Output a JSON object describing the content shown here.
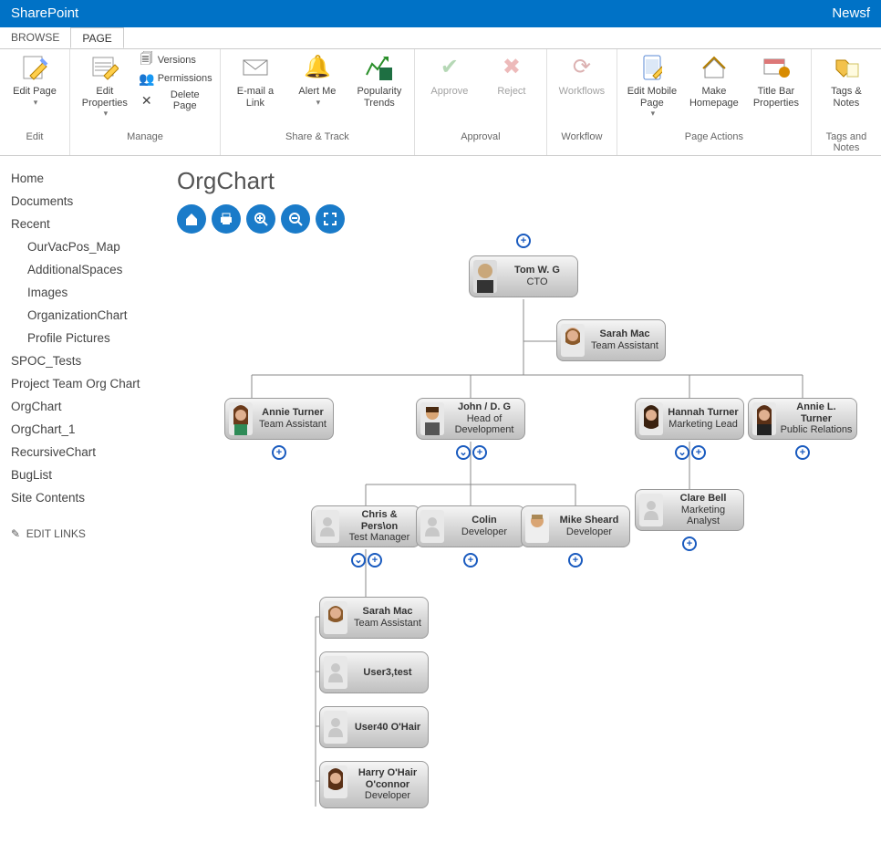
{
  "topbar": {
    "brand": "SharePoint",
    "right": "Newsf"
  },
  "tabs": {
    "browse": "BROWSE",
    "page": "PAGE"
  },
  "ribbon": {
    "edit": {
      "title": "Edit",
      "editPage": "Edit Page"
    },
    "manage": {
      "title": "Manage",
      "editProperties": "Edit Properties",
      "versions": "Versions",
      "permissions": "Permissions",
      "deletePage": "Delete Page"
    },
    "share": {
      "title": "Share & Track",
      "emailLink": "E-mail a Link",
      "alertMe": "Alert Me",
      "popularity": "Popularity Trends"
    },
    "approval": {
      "title": "Approval",
      "approve": "Approve",
      "reject": "Reject"
    },
    "workflow": {
      "title": "Workflow",
      "workflows": "Workflows"
    },
    "actions": {
      "title": "Page Actions",
      "editMobile": "Edit Mobile Page",
      "makeHome": "Make Homepage",
      "titleBar": "Title Bar Properties"
    },
    "tags": {
      "title": "Tags and Notes",
      "tagsNotes": "Tags & Notes"
    }
  },
  "sidebar": {
    "home": "Home",
    "documents": "Documents",
    "recent": "Recent",
    "recentItems": [
      "OurVacPos_Map",
      "AdditionalSpaces",
      "Images",
      "OrganizationChart",
      "Profile Pictures"
    ],
    "rest": [
      "SPOC_Tests",
      "Project Team Org Chart",
      "OrgChart",
      "OrgChart_1",
      "RecursiveChart",
      "BugList",
      "Site Contents"
    ],
    "editLinks": "EDIT LINKS"
  },
  "page": {
    "title": "OrgChart"
  },
  "nodes": {
    "tom": {
      "name": "Tom W. G",
      "title": "CTO"
    },
    "sarah1": {
      "name": "Sarah Mac",
      "title": "Team Assistant"
    },
    "annie": {
      "name": "Annie Turner",
      "title": "Team Assistant"
    },
    "john": {
      "name": "John / D. G",
      "title": "Head of Development"
    },
    "hannah": {
      "name": "Hannah Turner",
      "title": "Marketing Lead"
    },
    "anniel": {
      "name": "Annie L. Turner",
      "title": "Public Relations"
    },
    "chris": {
      "name": "Chris & Pers\\on",
      "title": "Test Manager"
    },
    "colin": {
      "name": "Colin",
      "title": "Developer"
    },
    "mike": {
      "name": "Mike Sheard",
      "title": "Developer"
    },
    "clare": {
      "name": "Clare Bell",
      "title": "Marketing Analyst"
    },
    "sarah2": {
      "name": "Sarah Mac",
      "title": "Team Assistant"
    },
    "user3": {
      "name": "User3,test",
      "title": ""
    },
    "user40": {
      "name": "User40 O'Hair",
      "title": ""
    },
    "harry": {
      "name": "Harry O'Hair O'connor",
      "title": "Developer"
    }
  }
}
